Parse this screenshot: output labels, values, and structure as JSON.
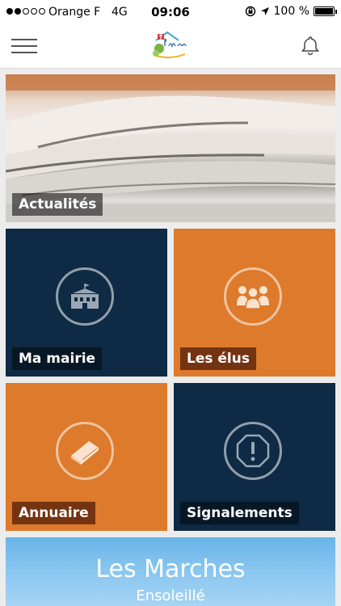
{
  "status_bar": {
    "carrier": "Orange F",
    "network": "4G",
    "time": "09:06",
    "battery": "100 %"
  },
  "nav": {
    "logo_text": "Les Marches"
  },
  "tiles": {
    "news": "Actualités",
    "mairie": "Ma mairie",
    "elus": "Les élus",
    "annuaire": "Annuaire",
    "signalements": "Signalements"
  },
  "weather": {
    "city": "Les Marches",
    "condition": "Ensoleillé"
  },
  "colors": {
    "navy": "#0e2a44",
    "orange": "#dd7a2b"
  },
  "icons": {
    "mairie": "town-hall-icon",
    "elus": "people-icon",
    "annuaire": "book-icon",
    "signalements": "alert-icon"
  }
}
